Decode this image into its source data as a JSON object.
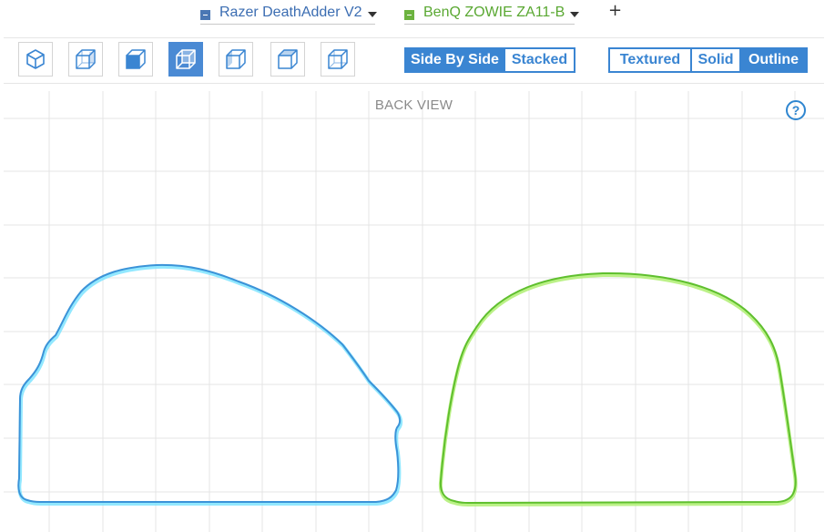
{
  "mice": [
    {
      "name": "Razer DeathAdder V2",
      "color": "#4a77b4"
    },
    {
      "name": "BenQ ZOWIE ZA11-B",
      "color": "#6cb33f"
    }
  ],
  "add_label": "+",
  "view_buttons": [
    {
      "icon": "cube-iso-icon",
      "active": false
    },
    {
      "icon": "cube-front-right-icon",
      "active": false
    },
    {
      "icon": "cube-front-icon",
      "active": false
    },
    {
      "icon": "cube-back-icon",
      "active": true
    },
    {
      "icon": "cube-side-icon",
      "active": false
    },
    {
      "icon": "cube-top-icon",
      "active": false
    },
    {
      "icon": "cube-bottom-icon",
      "active": false
    }
  ],
  "layout_modes": {
    "side_by_side": "Side By Side",
    "stacked": "Stacked",
    "selected": "Side By Side"
  },
  "render_modes": {
    "textured": "Textured",
    "solid": "Solid",
    "outline": "Outline",
    "selected": "Outline"
  },
  "view_title": "BACK VIEW",
  "help_label": "?",
  "colors": {
    "accent": "#3a85d2",
    "razer_outline": "#3b93d8",
    "razer_outline_glow": "#7fe4ff",
    "zowie_outline": "#5fbf2e",
    "zowie_outline_glow": "#b4f07a",
    "grid": "#e4e4e4"
  }
}
